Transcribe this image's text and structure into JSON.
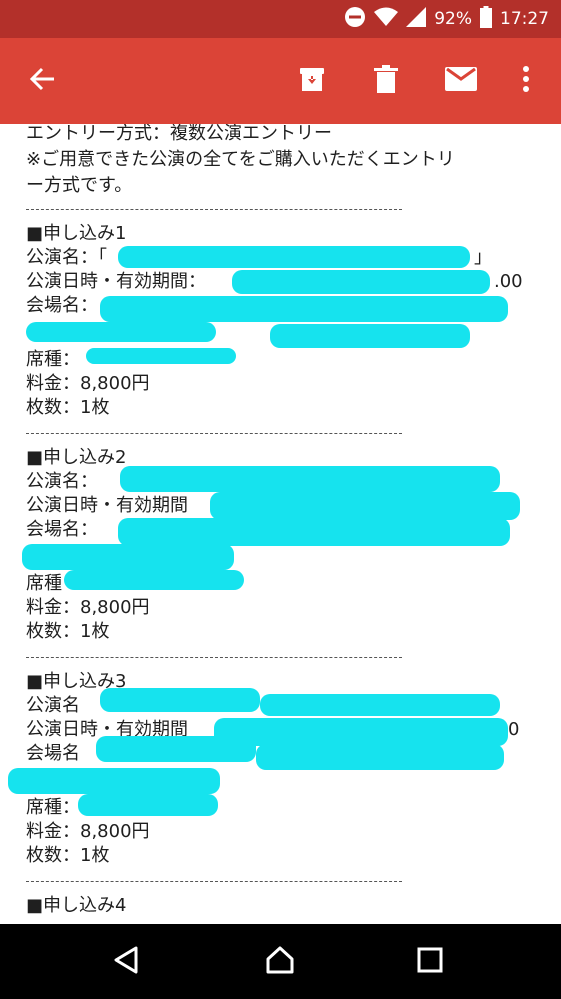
{
  "status": {
    "battery": "92%",
    "time": "17:27"
  },
  "email": {
    "entry_method": "エントリー方式：複数公演エントリー",
    "note_line1": "※ご用意できた公演の全てをご購入いただくエントリ",
    "note_line2": "ー方式です。",
    "separator": "------------------------------------------------------------",
    "applications": [
      {
        "heading": "■申し込み1",
        "name_label": "公演名：「",
        "name_tail": "」",
        "date_label": "公演日時・有効期間：",
        "date_tail": ".00",
        "venue_label": "会場名：",
        "seat_label": "席種：",
        "price": "料金：8,800円",
        "qty": "枚数：1枚"
      },
      {
        "heading": "■申し込み2",
        "name_label": "公演名：",
        "date_label": "公演日時・有効期間",
        "venue_label": "会場名：",
        "seat_label": "席種",
        "price": "料金：8,800円",
        "qty": "枚数：1枚"
      },
      {
        "heading": "■申し込み3",
        "name_label": "公演名",
        "date_label": "公演日時・有効期間",
        "date_tail": "0",
        "venue_label": "会場名",
        "seat_label": "席種：",
        "price": "料金：8,800円",
        "qty": "枚数：1枚"
      },
      {
        "heading": "■申し込み4"
      }
    ]
  },
  "colors": {
    "status_bar": "#b3302a",
    "toolbar": "#db4437",
    "redaction": "#16e3ee",
    "navbar": "#000000"
  },
  "icons": [
    "dnd-icon",
    "wifi-icon",
    "signal-icon",
    "battery-icon",
    "back-arrow-icon",
    "archive-icon",
    "delete-icon",
    "mail-icon",
    "overflow-menu-icon",
    "nav-back-icon",
    "nav-home-icon",
    "nav-recents-icon"
  ]
}
